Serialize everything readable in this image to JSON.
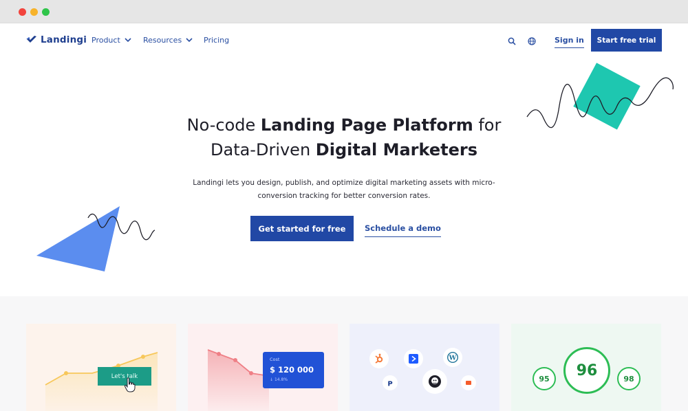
{
  "nav": {
    "logo": "Landingi",
    "items": [
      {
        "label": "Product"
      },
      {
        "label": "Resources"
      },
      {
        "label": "Pricing"
      }
    ],
    "signin": "Sign in",
    "trial": "Start free trial"
  },
  "hero": {
    "title_line1_pre": "No-code ",
    "title_line1_bold": "Landing Page Platform",
    "title_line1_post": " for",
    "title_line2_pre": "Data-Driven ",
    "title_line2_bold": "Digital Marketers",
    "subtitle_line1": "Landingi lets you design, publish, and optimize digital marketing assets with micro-",
    "subtitle_line2": "conversion tracking for better conversion rates.",
    "cta_primary": "Get started for free",
    "cta_secondary": "Schedule a demo"
  },
  "cards": {
    "talk_button": "Let's talk",
    "cost_label": "Cost",
    "cost_value": "$ 120 000",
    "cost_change": "14.8%",
    "scores": [
      "95",
      "96",
      "98"
    ]
  },
  "colors": {
    "brand": "#2148a5",
    "link": "#2a4fa2",
    "teal": "#1ec7b0",
    "blue_shape": "#5b8def",
    "score_green": "#2dbd55"
  }
}
